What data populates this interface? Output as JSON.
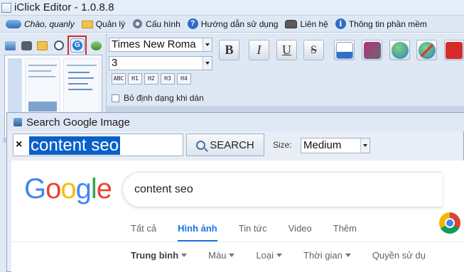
{
  "app": {
    "title": "iClick Editor - 1.0.8.8"
  },
  "menu": {
    "greeting": "Chào, quanly",
    "items": [
      "Quản lý",
      "Cấu hình",
      "Hướng dẫn sử dụng",
      "Liên hệ",
      "Thông tin phần mềm"
    ]
  },
  "toolbar": {
    "font_family": "Times New Roma",
    "font_size": "3",
    "format_buttons": [
      "B",
      "I",
      "U",
      "S"
    ],
    "heading_buttons": [
      "ABC",
      "H1",
      "H2",
      "H3",
      "H4"
    ],
    "strip_format_label": "Bỏ định dạng khi dán"
  },
  "dialog": {
    "title": "Search Google Image",
    "clear_label": "×",
    "query": "content seo",
    "search_button": "SEARCH",
    "size_label": "Size:",
    "size_value": "Medium"
  },
  "google": {
    "logo_letters": [
      "G",
      "o",
      "o",
      "g",
      "l",
      "e"
    ],
    "search_query": "content seo",
    "tabs": [
      "Tất cả",
      "Hình ảnh",
      "Tin tức",
      "Video",
      "Thêm"
    ],
    "active_tab_index": 1,
    "filters": [
      "Trung bình",
      "Màu",
      "Loại",
      "Thời gian",
      "Quyền sử dụ"
    ]
  },
  "colors": {
    "selection": "#0a60c9",
    "highlight_border": "#d62b2b",
    "google_blue": "#1a73e8"
  },
  "icons": {
    "menu": [
      "folder-icon",
      "gear-icon",
      "help-icon",
      "phone-icon",
      "info-icon"
    ],
    "left_toolbar": [
      "image-icon",
      "camera-icon",
      "folder-icon",
      "clock-icon",
      "google-icon",
      "link-icon"
    ]
  }
}
